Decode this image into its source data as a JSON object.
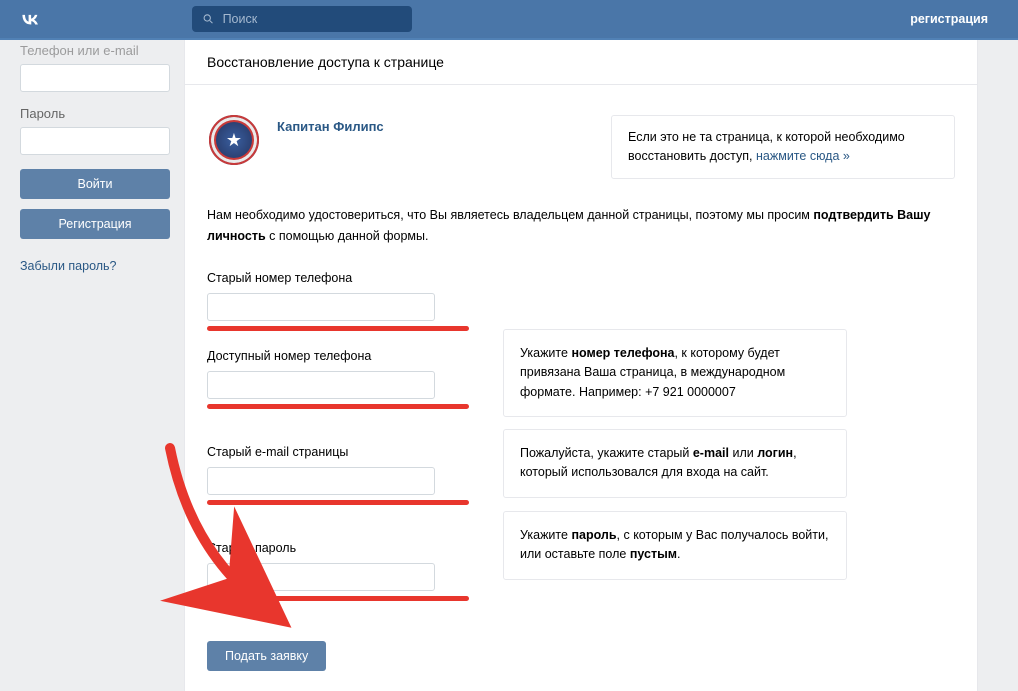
{
  "header": {
    "search_placeholder": "Поиск",
    "register_link": "регистрация"
  },
  "sidebar": {
    "phone_label": "Телефон или e-mail",
    "password_label": "Пароль",
    "login_button": "Войти",
    "register_button": "Регистрация",
    "forgot_link": "Забыли пароль?"
  },
  "main": {
    "title": "Восстановление доступа к странице",
    "profile_name": "Капитан Филипс",
    "wrong_page_hint_pre": "Если это не та страница, к которой необходимо восстановить доступ, ",
    "wrong_page_hint_link": "нажмите сюда »",
    "instruction_pre": "Нам необходимо удостовериться, что Вы являетесь владельцем данной страницы, поэтому мы просим ",
    "instruction_bold": "подтвердить Вашу личность",
    "instruction_post": " с помощью данной формы.",
    "fields": {
      "old_phone": "Старый номер телефона",
      "available_phone": "Доступный номер телефона",
      "old_email": "Старый e-mail страницы",
      "old_password": "Старый пароль"
    },
    "hints": {
      "phone_pre": "Укажите ",
      "phone_bold": "номер телефона",
      "phone_post": ", к которому будет привязана Ваша страница, в международном формате. Например: +7 921 0000007",
      "email_pre": "Пожалуйста, укажите старый ",
      "email_bold1": "e-mail",
      "email_mid": " или ",
      "email_bold2": "логин",
      "email_post": ", который использовался для входа на сайт.",
      "password_pre": "Укажите ",
      "password_bold1": "пароль",
      "password_mid": ", с которым у Вас получалось войти, или оставьте поле ",
      "password_bold2": "пустым",
      "password_post": "."
    },
    "submit": "Подать заявку"
  }
}
